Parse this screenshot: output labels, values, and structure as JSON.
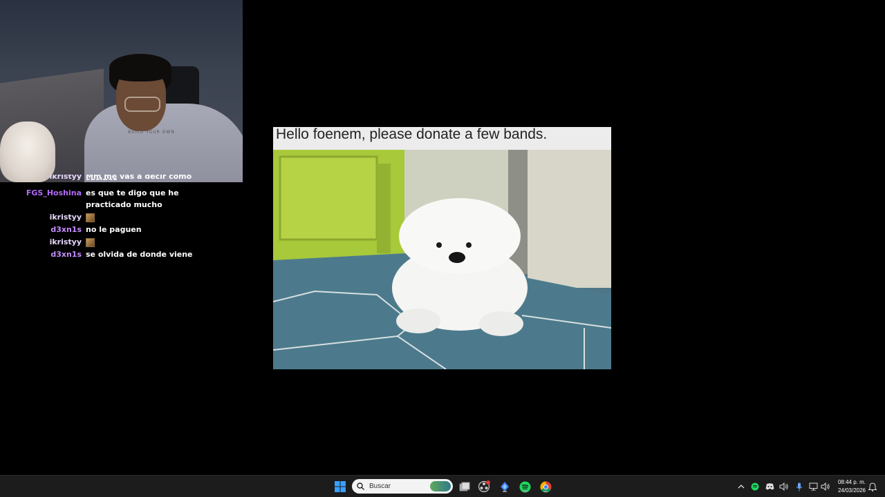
{
  "webcam": {
    "shirt_text": "BUILD YOUR OWN"
  },
  "chat": {
    "messages": [
      {
        "user": "ikristyy",
        "user_color": "#e9d8ff",
        "text": "Mm me vas a decir como cocinar"
      },
      {
        "user": "FGS_Hoshina",
        "user_color": "#b46bff",
        "text": "es que te digo que he practicado mucho"
      },
      {
        "user": "ikristyy",
        "user_color": "#e9d8ff",
        "text": "",
        "emote": "cat-emote"
      },
      {
        "user": "d3xn1s",
        "user_color": "#c68cff",
        "text": "no le paguen"
      },
      {
        "user": "ikristyy",
        "user_color": "#e9d8ff",
        "text": "",
        "emote": "cat-emote"
      },
      {
        "user": "d3xn1s",
        "user_color": "#c68cff",
        "text": "se olvida de donde viene"
      }
    ]
  },
  "meme": {
    "caption": "Hello foenem, please donate a few bands."
  },
  "taskbar": {
    "search_placeholder": "Buscar",
    "icons": [
      "windows-start-icon",
      "search-icon",
      "task-view-icon",
      "obs-icon",
      "visual-studio-icon",
      "spotify-icon",
      "chrome-icon"
    ],
    "tray_icons": [
      "chevron-up-icon",
      "spotify-tray-icon",
      "discord-icon",
      "volume-icon",
      "microphone-icon",
      "network-icon",
      "speaker-icon",
      "notification-icon"
    ],
    "time": "08:44 p. m.",
    "date": "24/03/2026"
  },
  "colors": {
    "taskbar_bg": "#1c1c1c",
    "accent_windows": "#3aa0ff",
    "spotify_green": "#1ed760"
  }
}
